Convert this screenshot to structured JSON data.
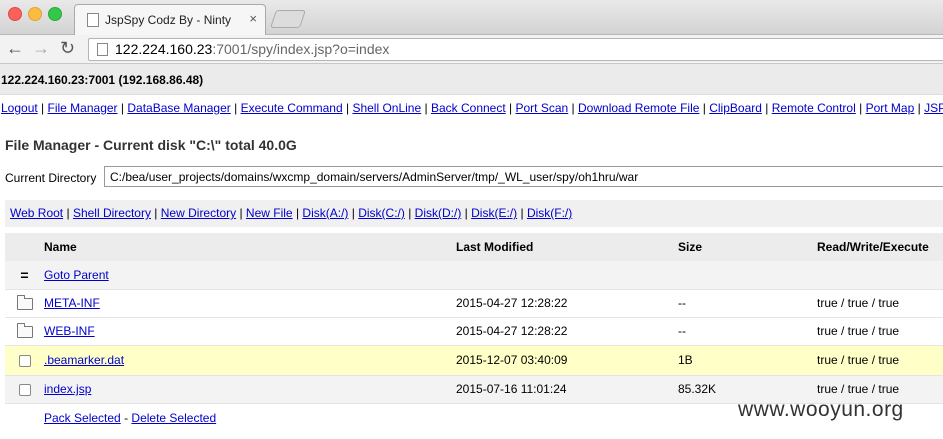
{
  "browser": {
    "tab_title": "JspSpy Codz By - Ninty",
    "tab_close": "×",
    "url_host": "122.224.160.23",
    "url_path": ":7001/spy/index.jsp?o=index",
    "back_icon": "←",
    "forward_icon": "→",
    "reload_icon": "↻"
  },
  "host": "122.224.160.23:7001 (192.168.86.48)",
  "menu": [
    "Logout",
    "File Manager",
    "DataBase Manager",
    "Execute Command",
    "Shell OnLine",
    "Back Connect",
    "Port Scan",
    "Download Remote File",
    "ClipBoard",
    "Remote Control",
    "Port Map",
    "JSP"
  ],
  "file_manager": {
    "title": "File Manager - Current disk \"C:\\\" total 40.0G",
    "current_dir_label": "Current Directory",
    "current_dir_value": "C:/bea/user_projects/domains/wxcmp_domain/servers/AdminServer/tmp/_WL_user/spy/oh1hru/war"
  },
  "disk_links": [
    "Web Root",
    "Shell Directory",
    "New Directory",
    "New File",
    "Disk(A:/)",
    "Disk(C:/)",
    "Disk(D:/)",
    "Disk(E:/)",
    "Disk(F:/)"
  ],
  "table": {
    "headers": [
      "Name",
      "Last Modified",
      "Size",
      "Read/Write/Execute"
    ],
    "parent_icon": "=",
    "parent_label": "Goto Parent",
    "rows": [
      {
        "name": "META-INF",
        "modified": "2015-04-27 12:28:22",
        "size": "--",
        "rwx": "true / true / true",
        "icon": "folder-icon"
      },
      {
        "name": "WEB-INF",
        "modified": "2015-04-27 12:28:22",
        "size": "--",
        "rwx": "true / true / true",
        "icon": "folder-icon"
      },
      {
        "name": ".beamarker.dat",
        "modified": "2015-12-07 03:40:09",
        "size": "1B",
        "rwx": "true / true / true",
        "icon": "checkbox"
      },
      {
        "name": "index.jsp",
        "modified": "2015-07-16 11:01:24",
        "size": "85.32K",
        "rwx": "true / true / true",
        "icon": "checkbox"
      }
    ]
  },
  "actions": {
    "pack": "Pack Selected",
    "dash": "-",
    "delete": "Delete Selected"
  },
  "watermark": "www.wooyun.org"
}
